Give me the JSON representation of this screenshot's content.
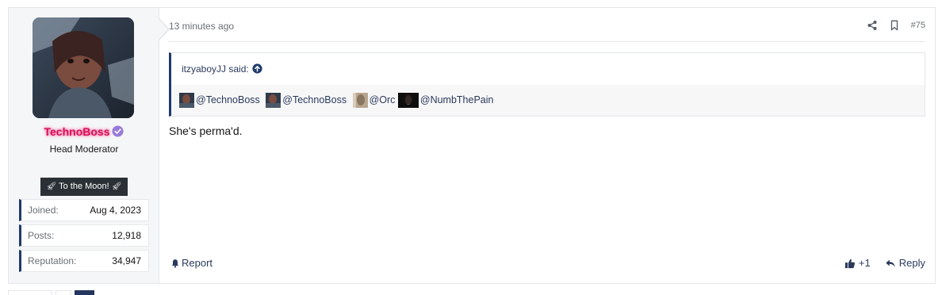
{
  "user": {
    "username": "TechnoBoss",
    "role": "Head Moderator",
    "verified_icon": "verified-check-icon",
    "banner": "To the Moon!",
    "banner_icon": "rocket-icon",
    "stats": {
      "joined_label": "Joined:",
      "joined_value": "Aug 4, 2023",
      "posts_label": "Posts:",
      "posts_value": "12,918",
      "rep_label": "Reputation:",
      "rep_value": "34,947"
    }
  },
  "post": {
    "time": "13 minutes ago",
    "number": "#75",
    "header_icons": [
      "share-icon",
      "bookmark-icon"
    ],
    "quote": {
      "author": "itzyaboyJJ said:",
      "mentions": [
        "@TechnoBoss",
        "@TechnoBoss",
        "@Orc",
        "@NumbThePain"
      ]
    },
    "message": "She's perma'd.",
    "report_label": "Report",
    "like_count": "+1",
    "reply_label": "Reply"
  },
  "colors": {
    "accent": "#1f3a6b",
    "username": "#d4145a",
    "link": "#2a3a5c"
  }
}
